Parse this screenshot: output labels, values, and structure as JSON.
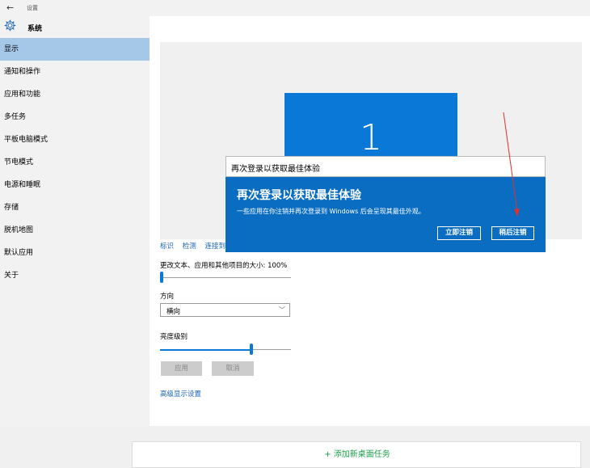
{
  "window": {
    "back_symbol": "←",
    "title": "设置"
  },
  "sidebar": {
    "header_label": "系统",
    "items": [
      {
        "label": "显示",
        "active": true
      },
      {
        "label": "通知和操作"
      },
      {
        "label": "应用和功能"
      },
      {
        "label": "多任务"
      },
      {
        "label": "平板电脑模式"
      },
      {
        "label": "节电模式"
      },
      {
        "label": "电源和睡眠"
      },
      {
        "label": "存储"
      },
      {
        "label": "脱机地图"
      },
      {
        "label": "默认应用"
      },
      {
        "label": "关于"
      }
    ]
  },
  "display": {
    "monitor_number": "1",
    "links": [
      "标识",
      "检测",
      "连接到"
    ],
    "scale_label": "更改文本、应用和其他项目的大小: 100%",
    "scale_value": 0,
    "orientation_label": "方向",
    "orientation_value": "横向",
    "brightness_label": "亮度级别",
    "brightness_value": 0.7,
    "apply_label": "应用",
    "cancel_label": "取消",
    "advanced_link": "高级显示设置"
  },
  "dialog": {
    "title": "再次登录以获取最佳体验",
    "heading": "再次登录以获取最佳体验",
    "message": "一些应用在你注销并再次登录到 Windows 后会呈现其最佳外观。",
    "signout_now": "立即注销",
    "signout_later": "稍后注销"
  },
  "footer": {
    "text": "+ 添加新桌面任务"
  },
  "colors": {
    "accent": "#0a78d7",
    "dialog_bg": "#0a6dc1",
    "sidebar_bg": "#f2f2f2",
    "active_item": "#a6c8e8",
    "annotation": "#e03030"
  },
  "icons": [
    "back-arrow-icon",
    "gear-icon",
    "chevron-down-icon"
  ]
}
